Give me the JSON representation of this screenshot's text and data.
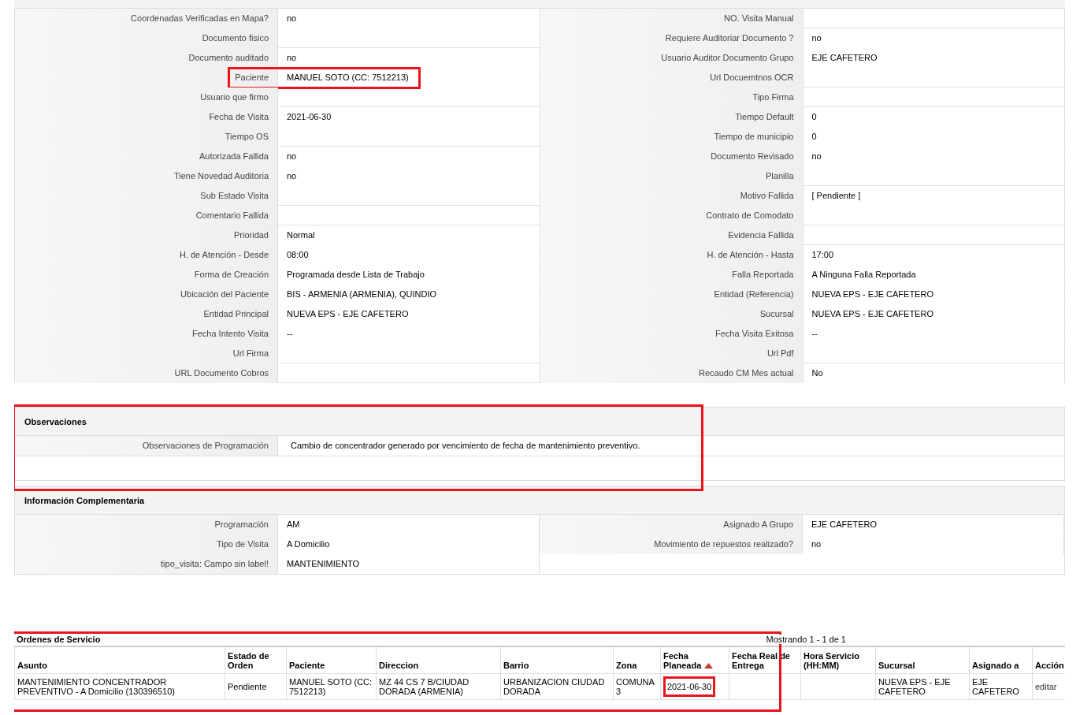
{
  "details": [
    {
      "left": {
        "label": "Coordenadas Verificadas en Mapa?",
        "value": "no",
        "highlighted": false
      },
      "right": {
        "label": "NO. Visita Manual",
        "highlighted": false
      }
    },
    {
      "left": {
        "label": "Documento fisico",
        "highlighted": false
      },
      "right": {
        "label": "Requiere Auditoriar Documento ?",
        "value": "no",
        "highlighted": false
      }
    },
    {
      "left": {
        "label": "Documento auditado",
        "value": "no",
        "highlighted": false
      },
      "right": {
        "label": "Usuario Auditor Documento Grupo",
        "value": "EJE CAFETERO",
        "highlighted": false
      }
    },
    {
      "left": {
        "label": "Paciente",
        "value": "MANUEL SOTO (CC: 7512213)",
        "highlighted": true
      },
      "right": {
        "label": "Url Docuemtnos OCR",
        "highlighted": false
      }
    },
    {
      "left": {
        "label": "Usuario que firmo",
        "highlighted": false
      },
      "right": {
        "label": "Tipo Firma",
        "highlighted": false
      }
    },
    {
      "left": {
        "label": "Fecha de Visita",
        "value": "2021-06-30",
        "highlighted": false
      },
      "right": {
        "label": "Tiempo Default",
        "value": "0",
        "highlighted": false
      }
    },
    {
      "left": {
        "label": "Tiempo OS",
        "highlighted": false
      },
      "right": {
        "label": "Tiempo de municipio",
        "value": "0",
        "highlighted": false
      }
    },
    {
      "left": {
        "label": "Autorizada Fallida",
        "value": "no",
        "highlighted": false
      },
      "right": {
        "label": "Documento Revisado",
        "value": "no",
        "highlighted": false
      }
    },
    {
      "left": {
        "label": "Tiene Novedad Auditoria",
        "value": "no",
        "highlighted": false
      },
      "right": {
        "label": "Planilla",
        "highlighted": false
      }
    },
    {
      "left": {
        "label": "Sub Estado Visita",
        "highlighted": false
      },
      "right": {
        "label": "Motivo Fallida",
        "value": "[ Pendiente ]",
        "highlighted": false
      }
    },
    {
      "left": {
        "label": "Comentario Fallida",
        "highlighted": false
      },
      "right": {
        "label": "Contrato de Comodato",
        "highlighted": false
      }
    },
    {
      "left": {
        "label": "Prioridad",
        "value": "Normal",
        "highlighted": false
      },
      "right": {
        "label": "Evidencia Fallida",
        "highlighted": false
      }
    },
    {
      "left": {
        "label": "H. de Atención - Desde",
        "value": "08:00",
        "highlighted": false
      },
      "right": {
        "label": "H. de Atención - Hasta",
        "value": "17:00",
        "highlighted": false
      }
    },
    {
      "left": {
        "label": "Forma de Creación",
        "value": "Programada desde Lista de Trabajo",
        "highlighted": false
      },
      "right": {
        "label": "Falla Reportada",
        "value": "A Ninguna Falla Reportada",
        "highlighted": false
      }
    },
    {
      "left": {
        "label": "Ubicación del Paciente",
        "value": "BIS - ARMENIA (ARMENIA), QUINDIO",
        "highlighted": false
      },
      "right": {
        "label": "Entidad (Referencia)",
        "value": "NUEVA EPS - EJE CAFETERO",
        "highlighted": false
      }
    },
    {
      "left": {
        "label": "Entidad Principal",
        "value": "NUEVA EPS - EJE CAFETERO",
        "highlighted": false
      },
      "right": {
        "label": "Sucursal",
        "value": "NUEVA EPS - EJE CAFETERO",
        "highlighted": false
      }
    },
    {
      "left": {
        "label": "Fecha Intento Visita",
        "value": "--",
        "highlighted": false
      },
      "right": {
        "label": "Fecha Visita Exitosa",
        "value": "--",
        "highlighted": false
      }
    },
    {
      "left": {
        "label": "Url Firma",
        "highlighted": false
      },
      "right": {
        "label": "Url Pdf",
        "highlighted": false
      }
    },
    {
      "left": {
        "label": "URL Documento Cobros",
        "highlighted": false
      },
      "right": {
        "label": "Recaudo CM Mes actual",
        "value": "No",
        "highlighted": false
      }
    }
  ],
  "observaciones": {
    "title": "Observaciones",
    "highlighted": true,
    "label": "Observaciones de Programación",
    "value": "Cambio de concentrador generado por vencimiento de fecha de mantenimiento preventivo."
  },
  "informacion": {
    "title": "Información Complementaria",
    "rows": [
      {
        "left": {
          "label": "Programación",
          "value": "AM"
        },
        "right": {
          "label": "Asignado A Grupo",
          "value": "EJE CAFETERO"
        }
      },
      {
        "left": {
          "label": "Tipo de Visita",
          "value": "A Domicilio"
        },
        "right": {
          "label": "Movimiento de repuestos realizado?",
          "value": "no"
        }
      },
      {
        "left": {
          "label": "tipo_visita: Campo sin label!",
          "value": "MANTENIMIENTO"
        }
      }
    ]
  },
  "ordenes": {
    "title": "Ordenes de Servicio",
    "count": "Mostrando 1 - 1 de 1",
    "highlighted": true,
    "columns": [
      {
        "label": "Asunto",
        "sorted": false
      },
      {
        "label": "Estado de Orden",
        "sorted": false
      },
      {
        "label": "Paciente",
        "sorted": false
      },
      {
        "label": "Direccion",
        "sorted": false
      },
      {
        "label": "Barrio",
        "sorted": false
      },
      {
        "label": "Zona",
        "sorted": false
      },
      {
        "label": "Fecha Planeada",
        "sorted": true
      },
      {
        "label": "Fecha Real de Entrega",
        "sorted": false
      },
      {
        "label": "Hora Servicio (HH:MM)",
        "sorted": false
      },
      {
        "label": "Sucursal",
        "sorted": false
      },
      {
        "label": "Asignado a",
        "sorted": false
      },
      {
        "label": "Acción",
        "sorted": false
      }
    ],
    "rows": [
      {
        "cells": [
          {
            "text": "MANTENIMIENTO CONCENTRADOR PREVENTIVO - A Domicilio (130396510)",
            "kind": "text",
            "highlighted": false
          },
          {
            "text": "Pendiente",
            "kind": "text",
            "highlighted": false
          },
          {
            "text": "MANUEL SOTO (CC: 7512213)",
            "kind": "text",
            "highlighted": false
          },
          {
            "text": "MZ 44 CS 7 B/CIUDAD DORADA (ARMENIA)",
            "kind": "text",
            "highlighted": false
          },
          {
            "text": "URBANIZACION CIUDAD DORADA",
            "kind": "text",
            "highlighted": false
          },
          {
            "text": "COMUNA 3",
            "kind": "text",
            "highlighted": false
          },
          {
            "text": "2021-06-30",
            "kind": "text",
            "highlighted": true
          },
          {
            "kind": "empty",
            "highlighted": false
          },
          {
            "kind": "empty",
            "highlighted": false
          },
          {
            "text": "NUEVA EPS - EJE CAFETERO",
            "kind": "text",
            "highlighted": false
          },
          {
            "text": "EJE CAFETERO",
            "kind": "text",
            "highlighted": false
          },
          {
            "text": "editar",
            "kind": "link",
            "highlighted": false
          }
        ]
      }
    ]
  }
}
